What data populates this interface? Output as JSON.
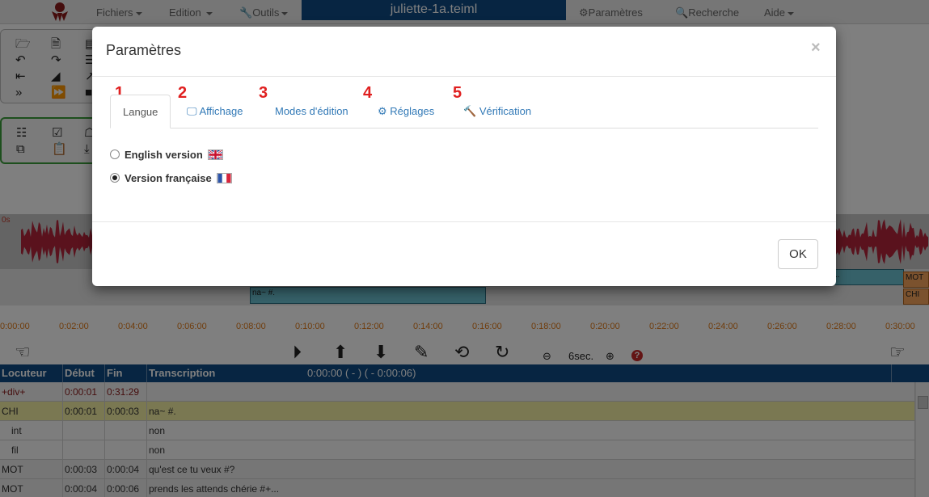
{
  "navbar": {
    "menu_fichiers": "Fichiers",
    "menu_edition": "Edition",
    "menu_outils": "Outils",
    "file_title": "juliette-1a.teiml",
    "parametres": "Paramètres",
    "recherche": "Recherche",
    "aide": "Aide"
  },
  "waveform": {
    "start_label": "0s"
  },
  "segments": {
    "seg1_text": "na~ #.",
    "seg_mot": "MOT",
    "seg_chi": "CHI"
  },
  "timeline": [
    "0:00:00",
    "0:02:00",
    "0:04:00",
    "0:06:00",
    "0:08:00",
    "0:10:00",
    "0:12:00",
    "0:14:00",
    "0:16:00",
    "0:18:00",
    "0:20:00",
    "0:22:00",
    "0:24:00",
    "0:26:00",
    "0:28:00",
    "0:30:00"
  ],
  "controls": {
    "duration": "6sec.",
    "help": "?"
  },
  "table": {
    "headers": {
      "locuteur": "Locuteur",
      "debut": "Début",
      "fin": "Fin",
      "transcription": "Transcription",
      "time_info": "0:00:00 ( - )  ( - 0:00:06)"
    },
    "rows": [
      {
        "loc": "+div+",
        "debut": "0:00:01",
        "fin": "0:31:29",
        "trans": ""
      },
      {
        "loc": "CHI",
        "debut": "0:00:01",
        "fin": "0:00:03",
        "trans": "na~ #."
      },
      {
        "loc": "int",
        "debut": "",
        "fin": "",
        "trans": "non"
      },
      {
        "loc": "fil",
        "debut": "",
        "fin": "",
        "trans": "non"
      },
      {
        "loc": "MOT",
        "debut": "0:00:03",
        "fin": "0:00:04",
        "trans": "qu'est ce tu veux #?"
      },
      {
        "loc": "MOT",
        "debut": "0:00:04",
        "fin": "0:00:06",
        "trans": "prends les attends chérie #+..."
      }
    ]
  },
  "modal": {
    "title": "Paramètres",
    "close": "×",
    "tabs": [
      {
        "num": "1",
        "label": "Langue"
      },
      {
        "num": "2",
        "label": "Affichage"
      },
      {
        "num": "3",
        "label": "Modes d'édition"
      },
      {
        "num": "4",
        "label": "Réglages"
      },
      {
        "num": "5",
        "label": "Vérification"
      }
    ],
    "options": {
      "english": "English version",
      "french": "Version française"
    },
    "selected_language": "Version française",
    "ok": "OK"
  },
  "colors": {
    "brand": "#0e4b84",
    "link": "#337ab7",
    "annotation_red": "#e02020",
    "timeline_orange": "#e07b1a",
    "highlight_row": "#f4f1a4"
  }
}
